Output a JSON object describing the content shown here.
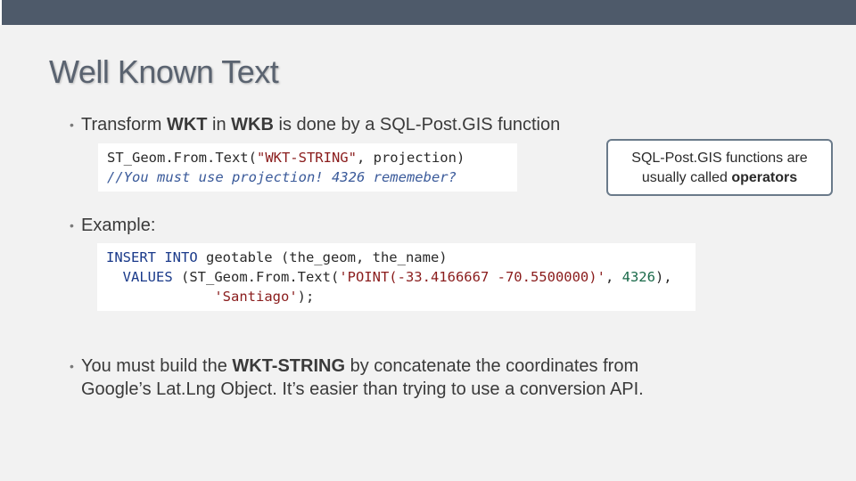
{
  "slide": {
    "title": "Well Known Text",
    "bullet1": {
      "parts": [
        "Transform ",
        "WKT",
        " in ",
        "WKB",
        " is done by a SQL-Post.GIS function"
      ]
    },
    "code1": {
      "line1": {
        "func": "ST_Geom.From.Text(",
        "str": "\"WKT-STRING\"",
        "rest": ", projection)"
      },
      "line2": "//You must use projection! 4326 rememeber?"
    },
    "callout": {
      "line1": "SQL-Post.GIS functions are",
      "line2_prefix": "usually called ",
      "line2_bold": "operators"
    },
    "bullet2": {
      "text": "Example:"
    },
    "code2": {
      "l1_kw": "INSERT INTO",
      "l1_rest": " geotable (the_geom, the_name)",
      "l2_kw": "VALUES",
      "l2_a": " (ST_Geom.From.Text(",
      "l2_str": "'POINT(-33.4166667 -70.5500000)'",
      "l2_b": ", ",
      "l2_num": "4326",
      "l2_c": "),",
      "l3_str": "'Santiago'",
      "l3_rest": ");"
    },
    "bullet3": {
      "parts": [
        "You must build the ",
        "WKT-STRING",
        " by concatenate the coordinates from"
      ],
      "line2": "Google’s Lat.Lng Object. It’s easier than trying to use a conversion API."
    },
    "bullet_glyph": "•"
  }
}
